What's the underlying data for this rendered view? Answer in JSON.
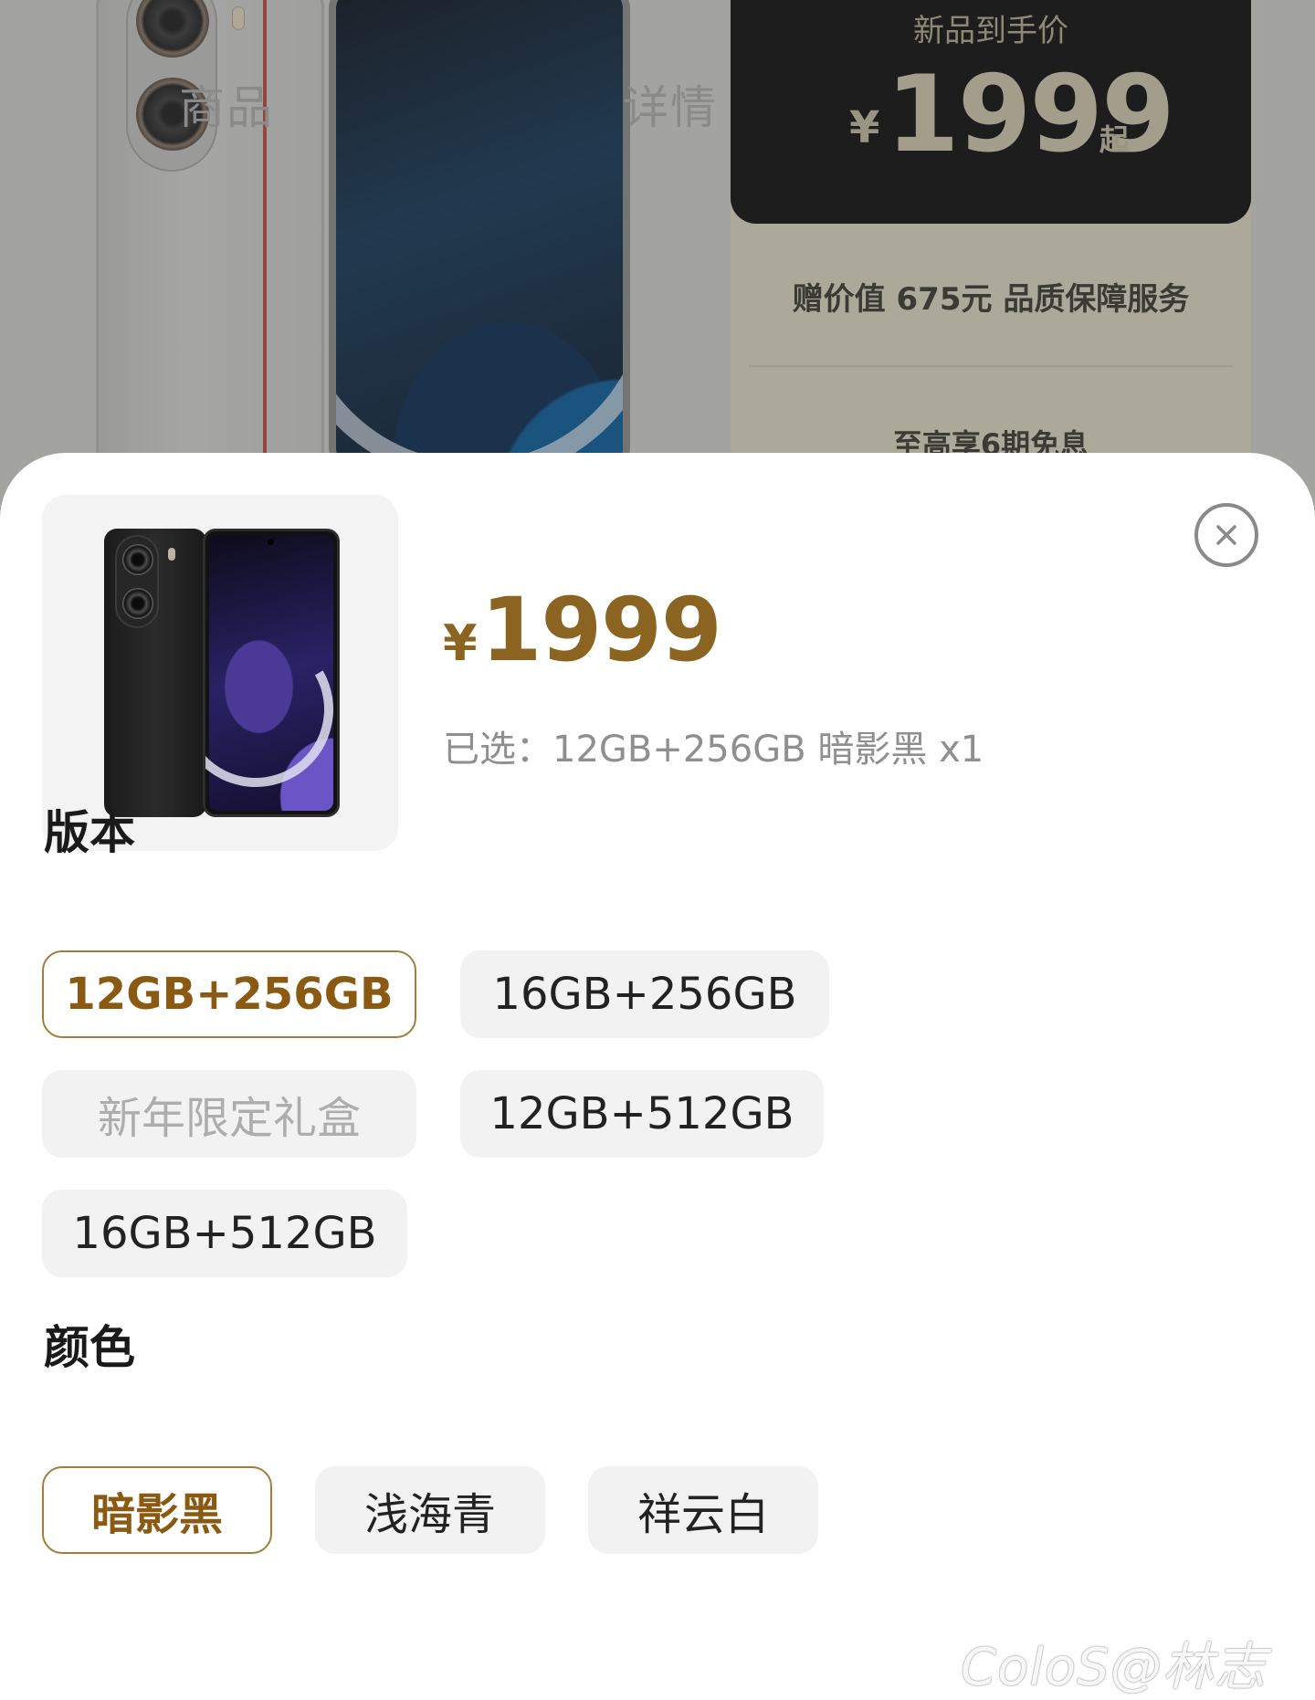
{
  "background_page": {
    "tab_left": "商品",
    "tab_right": "详情",
    "promo_header": "新品到手价",
    "promo_currency": "¥",
    "promo_price": "1999",
    "promo_suffix": "起",
    "promo_gift": "赠价值 675元 品质保障服务",
    "promo_installment": "至高享6期免息"
  },
  "sheet": {
    "price_currency": "¥",
    "price_value": "1999",
    "selected_label": "已选：12GB+256GB 暗影黑 x1",
    "version_title": "版本",
    "versions": [
      {
        "label": "12GB+256GB",
        "state": "selected"
      },
      {
        "label": "16GB+256GB",
        "state": "normal"
      },
      {
        "label": "新年限定礼盒",
        "state": "disabled"
      },
      {
        "label": "12GB+512GB",
        "state": "normal"
      },
      {
        "label": "16GB+512GB",
        "state": "normal"
      }
    ],
    "color_title": "颜色",
    "colors": [
      {
        "label": "暗影黑",
        "state": "selected"
      },
      {
        "label": "浅海青",
        "state": "normal"
      },
      {
        "label": "祥云白",
        "state": "normal"
      }
    ]
  },
  "watermark": "ColoS@林志炫",
  "icons": {
    "close": "close-icon"
  },
  "colors_theme": {
    "accent_gold": "#8a6420",
    "selected_border": "#a27c3a",
    "chip_bg": "#f2f2f2"
  }
}
